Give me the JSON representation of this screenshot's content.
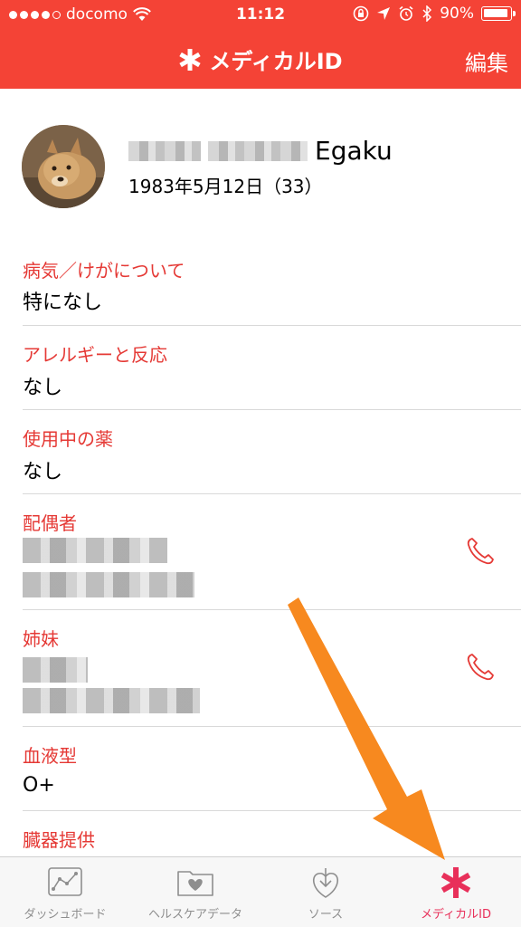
{
  "status_bar": {
    "carrier": "docomo",
    "time": "11:12",
    "battery": "90%",
    "battery_level": 0.9
  },
  "nav": {
    "title": "メディカルID",
    "edit_label": "編集"
  },
  "profile": {
    "name": "Egaku",
    "dob": "1983年5月12日（33）"
  },
  "sections": {
    "conditions": {
      "label": "病気／けがについて",
      "value": "特になし"
    },
    "allergies": {
      "label": "アレルギーと反応",
      "value": "なし"
    },
    "medications": {
      "label": "使用中の薬",
      "value": "なし"
    },
    "spouse": {
      "label": "配偶者"
    },
    "sister": {
      "label": "姉妹"
    },
    "blood_type": {
      "label": "血液型",
      "value": "O+"
    },
    "organ_donor": {
      "label": "臓器提供"
    }
  },
  "tabs": [
    {
      "label": "ダッシュボード",
      "icon": "dashboard-chart-icon"
    },
    {
      "label": "ヘルスケアデータ",
      "icon": "health-data-folder-icon"
    },
    {
      "label": "ソース",
      "icon": "sources-download-heart-icon"
    },
    {
      "label": "メディカルID",
      "icon": "medical-id-asterisk-icon"
    }
  ],
  "colors": {
    "accent_red": "#f44336",
    "label_red": "#e53935",
    "active_tab": "#e8305a",
    "annotation_arrow": "#f7891f"
  }
}
